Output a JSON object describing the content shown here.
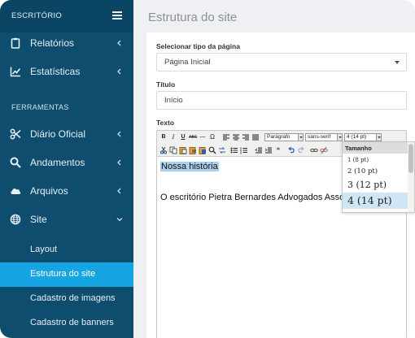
{
  "sidebar": {
    "brand": "ESCRITÓRIO",
    "items": [
      {
        "label": "Relatórios",
        "icon": "clipboard-icon"
      },
      {
        "label": "Estatísticas",
        "icon": "line-chart-icon"
      }
    ],
    "section": "FERRAMENTAS",
    "tools": [
      {
        "label": "Diário Oficial",
        "icon": "scissors-icon"
      },
      {
        "label": "Andamentos",
        "icon": "search-icon"
      },
      {
        "label": "Arquivos",
        "icon": "cloud-icon"
      },
      {
        "label": "Site",
        "icon": "globe-icon"
      }
    ],
    "sub_items": [
      "Layout",
      "Estrutura do site",
      "Cadastro de imagens",
      "Cadastro de banners"
    ],
    "active_sub": "Estrutura do site",
    "colors": {
      "background": "#0e4d6e",
      "active": "#15a5e2"
    }
  },
  "main": {
    "title": "Estrutura do site",
    "page_type_label": "Selecionar tipo da página",
    "page_type_value": "Página Inicial",
    "title_label": "Título",
    "title_value": "Início",
    "text_label": "Texto"
  },
  "editor": {
    "format_select": "Parágrafo",
    "font_select": "sans-serif",
    "size_select": "4 (14 pt)",
    "content_heading": "Nossa história",
    "content_body": "O escritório Pietra Bernardes Advogados Associados"
  },
  "size_dropdown": {
    "header": "Tamanho",
    "options": [
      "1 (8 pt)",
      "2 (10 pt)",
      "3 (12 pt)",
      "4 (14 pt)"
    ],
    "selected": "4 (14 pt)"
  }
}
